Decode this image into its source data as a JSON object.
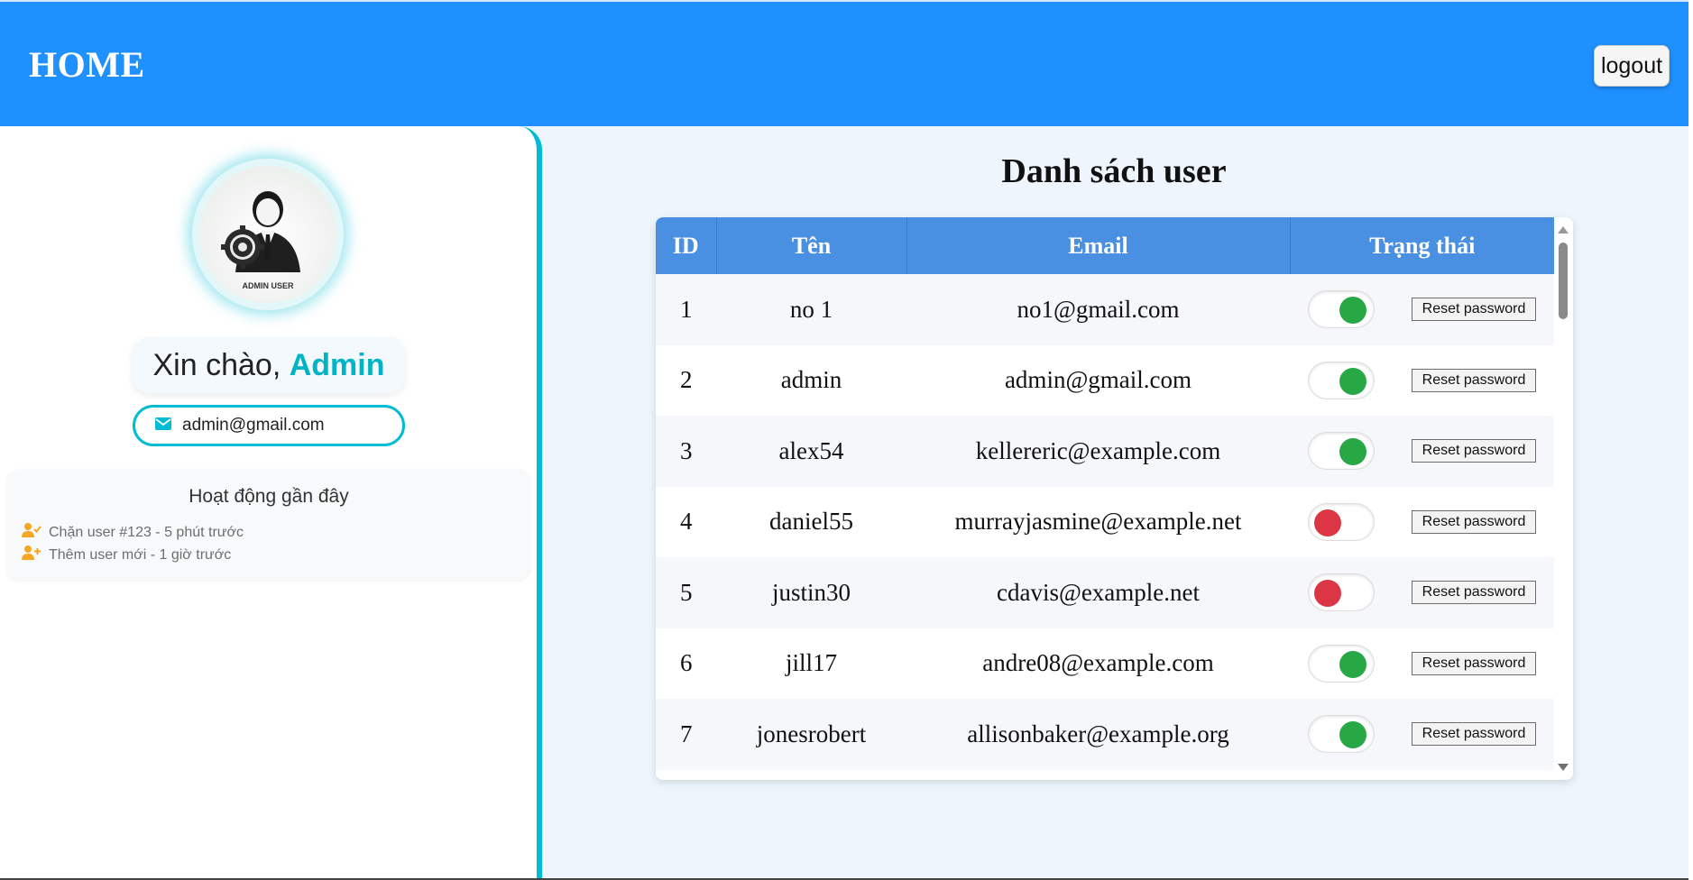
{
  "header": {
    "title": "HOME",
    "logout_label": "logout",
    "color": "#1e90ff"
  },
  "sidebar": {
    "avatar_badge": "ADMIN USER",
    "greeting_prefix": "Xin chào, ",
    "greeting_name": "Admin",
    "email": "admin@gmail.com",
    "accent_color": "#00bcd4",
    "activity": {
      "title": "Hoạt động gần đây",
      "items": [
        {
          "icon": "user-check-icon",
          "text": "Chặn user #123 - 5 phút trước"
        },
        {
          "icon": "user-plus-icon",
          "text": "Thêm user mới - 1 giờ trước"
        }
      ]
    }
  },
  "main": {
    "title": "Danh sách user",
    "table": {
      "columns": [
        "ID",
        "Tên",
        "Email",
        "Trạng thái"
      ],
      "reset_label": "Reset password",
      "rows": [
        {
          "id": "1",
          "name": "no 1",
          "email": "no1@gmail.com",
          "active": true
        },
        {
          "id": "2",
          "name": "admin",
          "email": "admin@gmail.com",
          "active": true
        },
        {
          "id": "3",
          "name": "alex54",
          "email": "kellereric@example.com",
          "active": true
        },
        {
          "id": "4",
          "name": "daniel55",
          "email": "murrayjasmine@example.net",
          "active": false
        },
        {
          "id": "5",
          "name": "justin30",
          "email": "cdavis@example.net",
          "active": false
        },
        {
          "id": "6",
          "name": "jill17",
          "email": "andre08@example.com",
          "active": true
        },
        {
          "id": "7",
          "name": "jonesrobert",
          "email": "allisonbaker@example.org",
          "active": true
        }
      ],
      "status_colors": {
        "on": "#28a745",
        "off": "#dc3545"
      },
      "header_color": "#4a90e2"
    }
  }
}
